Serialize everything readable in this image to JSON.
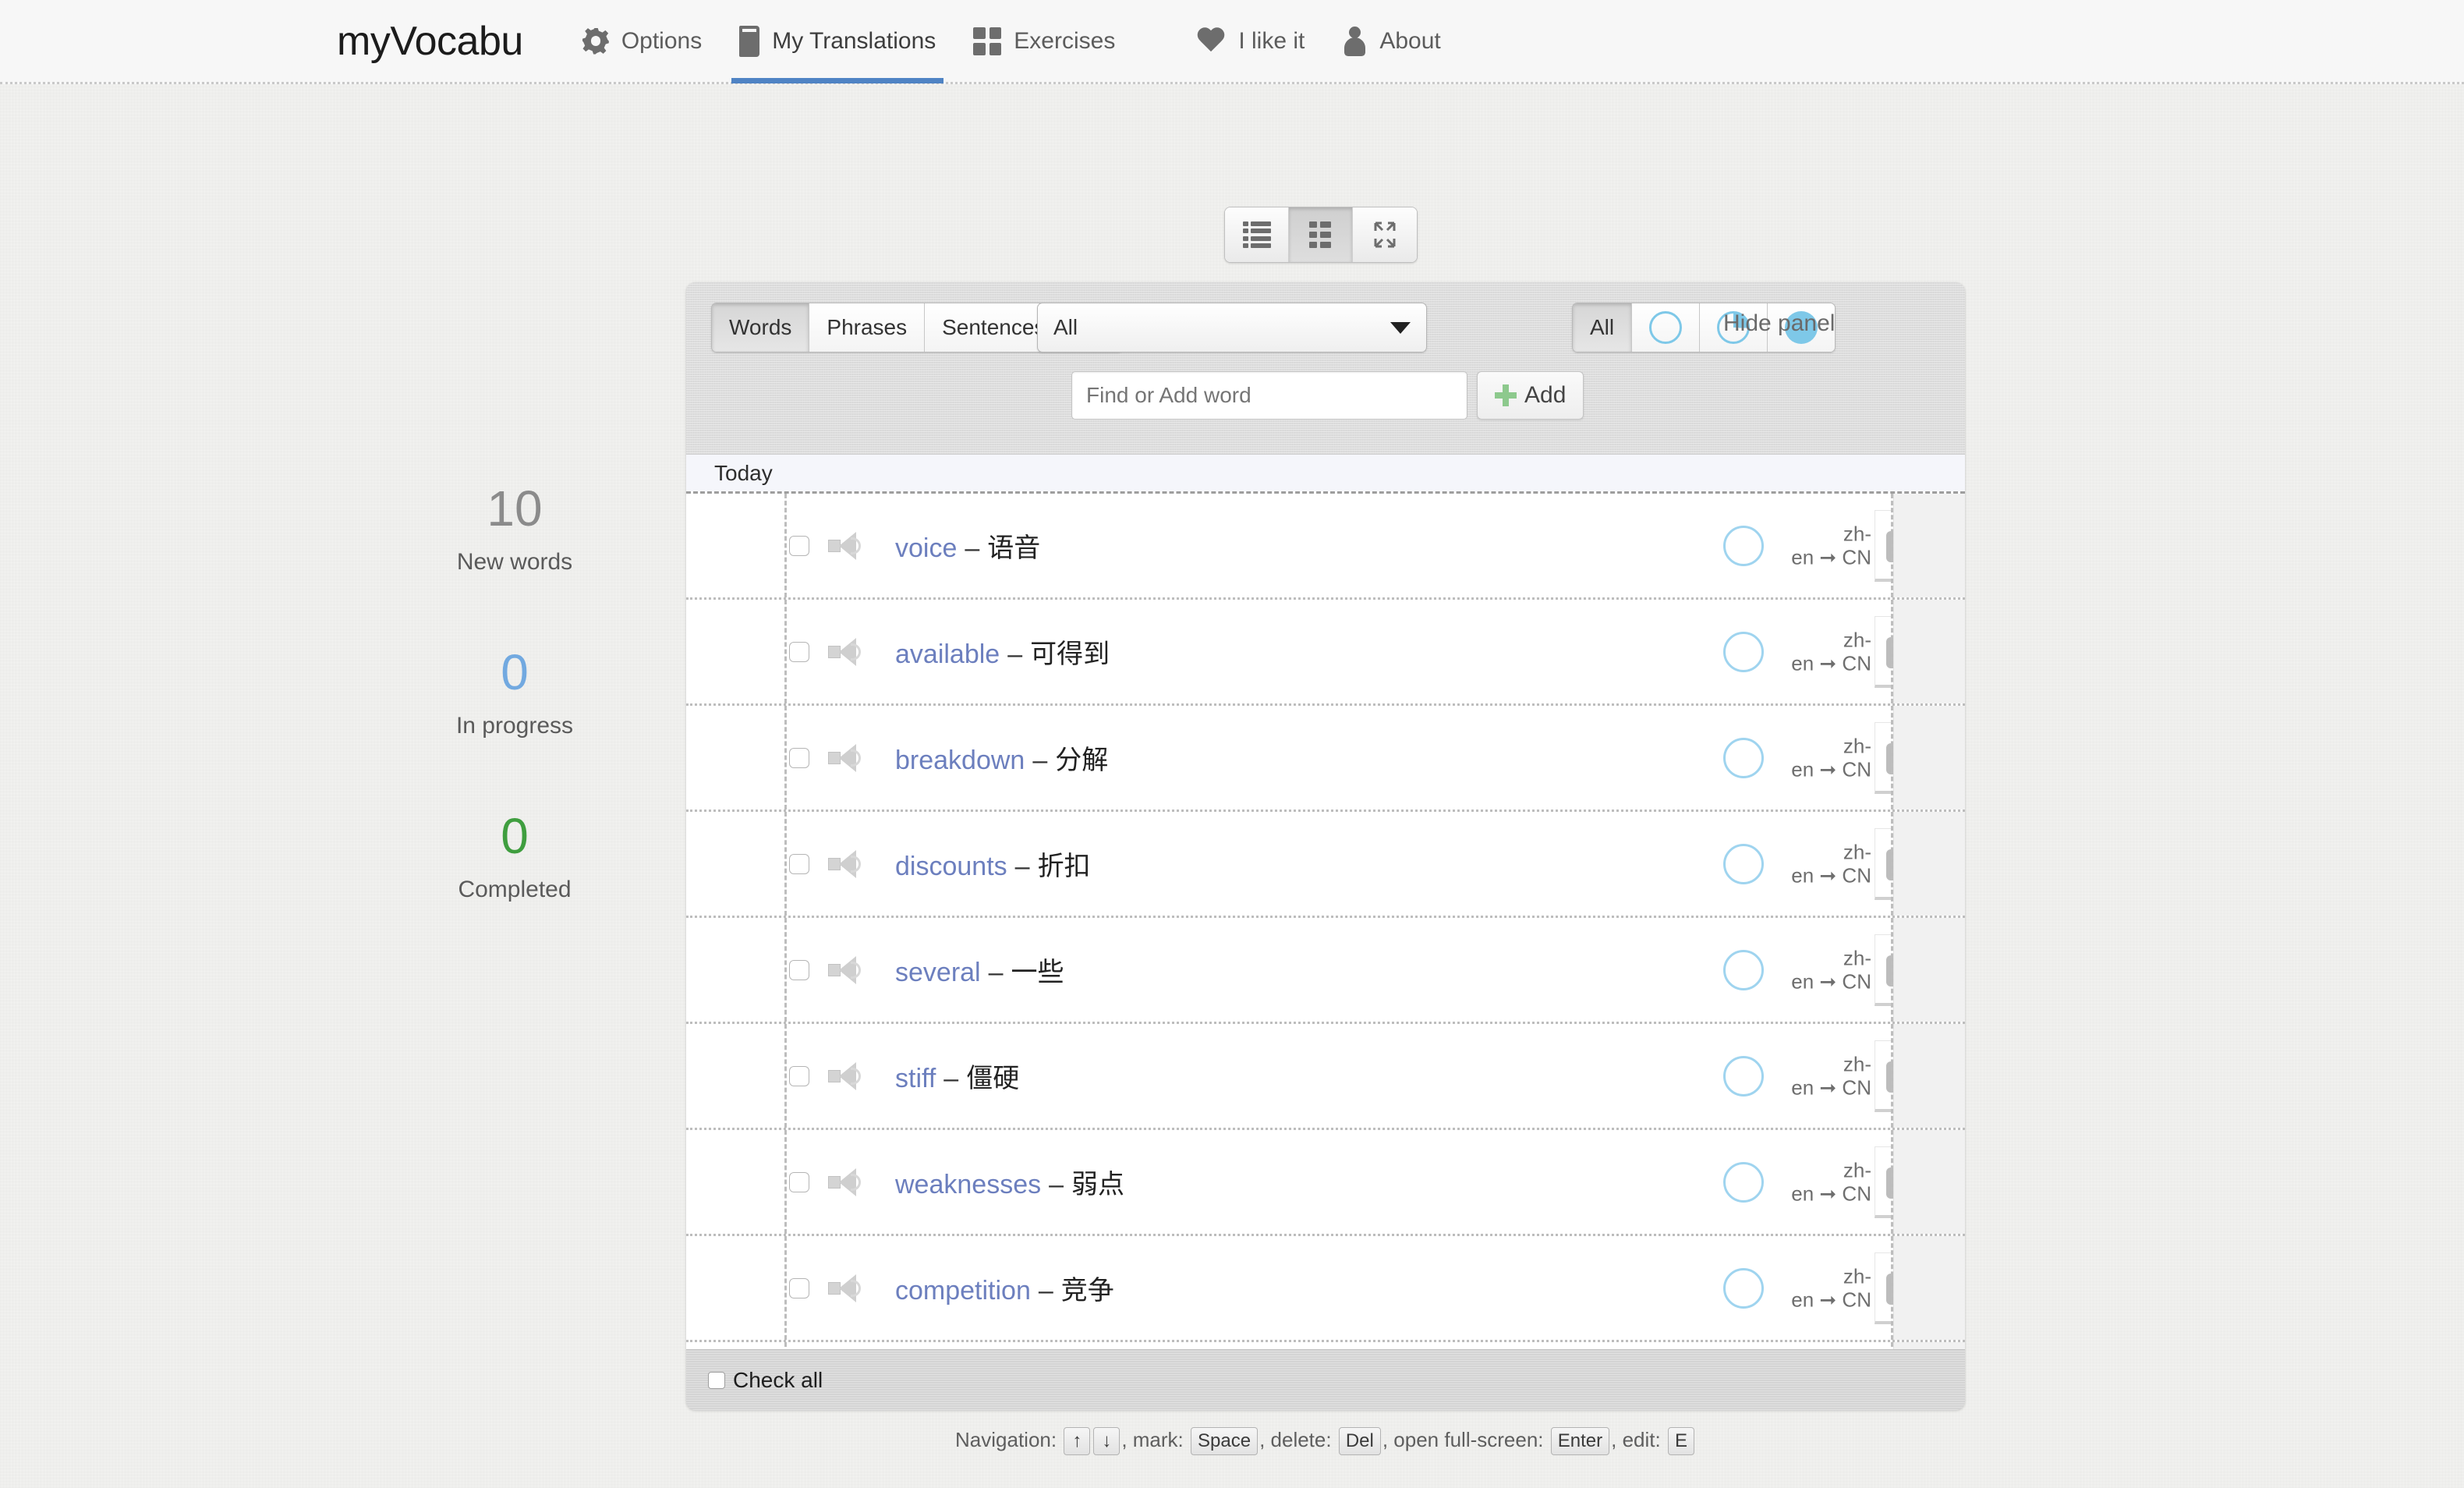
{
  "app": {
    "brand": "myVocabu"
  },
  "nav": [
    {
      "label": "Options",
      "icon": "gear-icon",
      "active": false
    },
    {
      "label": "My Translations",
      "icon": "book-icon",
      "active": true
    },
    {
      "label": "Exercises",
      "icon": "grid-icon",
      "active": false
    },
    {
      "label": "I like it",
      "icon": "heart-icon",
      "active": false
    },
    {
      "label": "About",
      "icon": "person-icon",
      "active": false
    }
  ],
  "view_toggle": {
    "options": [
      "list-view",
      "card-view",
      "fullscreen-view"
    ],
    "active": "card-view"
  },
  "filters": {
    "type_buttons": [
      "Words",
      "Phrases",
      "Sentences",
      "All"
    ],
    "type_active": "Words",
    "language_select": {
      "value": "All"
    },
    "status_all_label": "All",
    "status_active": "All",
    "hide_panel_label": "Hide panel"
  },
  "search": {
    "placeholder": "Find or Add word",
    "value": "",
    "add_label": "Add"
  },
  "list": {
    "group_label": "Today",
    "lang_from": "zh-en",
    "lang_to": "CN",
    "rows": [
      {
        "word": "voice",
        "dash": "–",
        "translation": "语音"
      },
      {
        "word": "available",
        "dash": "–",
        "translation": "可得到"
      },
      {
        "word": "breakdown",
        "dash": "–",
        "translation": "分解"
      },
      {
        "word": "discounts",
        "dash": "–",
        "translation": "折扣"
      },
      {
        "word": "several",
        "dash": "–",
        "translation": "一些"
      },
      {
        "word": "stiff",
        "dash": "–",
        "translation": "僵硬"
      },
      {
        "word": "weaknesses",
        "dash": "–",
        "translation": "弱点"
      },
      {
        "word": "competition",
        "dash": "–",
        "translation": "竞争"
      }
    ]
  },
  "check_all": {
    "label": "Check all",
    "checked": false
  },
  "hints": {
    "nav_label": "Navigation:",
    "key_up": "↑",
    "key_down": "↓",
    "mark_label": ", mark:",
    "key_space": "Space",
    "delete_label": ", delete:",
    "key_del": "Del",
    "fullscreen_label": ", open full-screen:",
    "key_enter": "Enter",
    "edit_label": ", edit:",
    "key_e": "E"
  },
  "stats": [
    {
      "number": "10",
      "label": "New words",
      "color": "#8b8b8b"
    },
    {
      "number": "0",
      "label": "In progress",
      "color": "#72a9e0"
    },
    {
      "number": "0",
      "label": "Completed",
      "color": "#3f9e3f"
    }
  ],
  "colors": {
    "accent_blue": "#4f83c4",
    "word_link": "#6c7fbe",
    "status_blue": "#7ec8e8",
    "add_green": "#8dc98d",
    "done_green": "#3f9e3f"
  }
}
